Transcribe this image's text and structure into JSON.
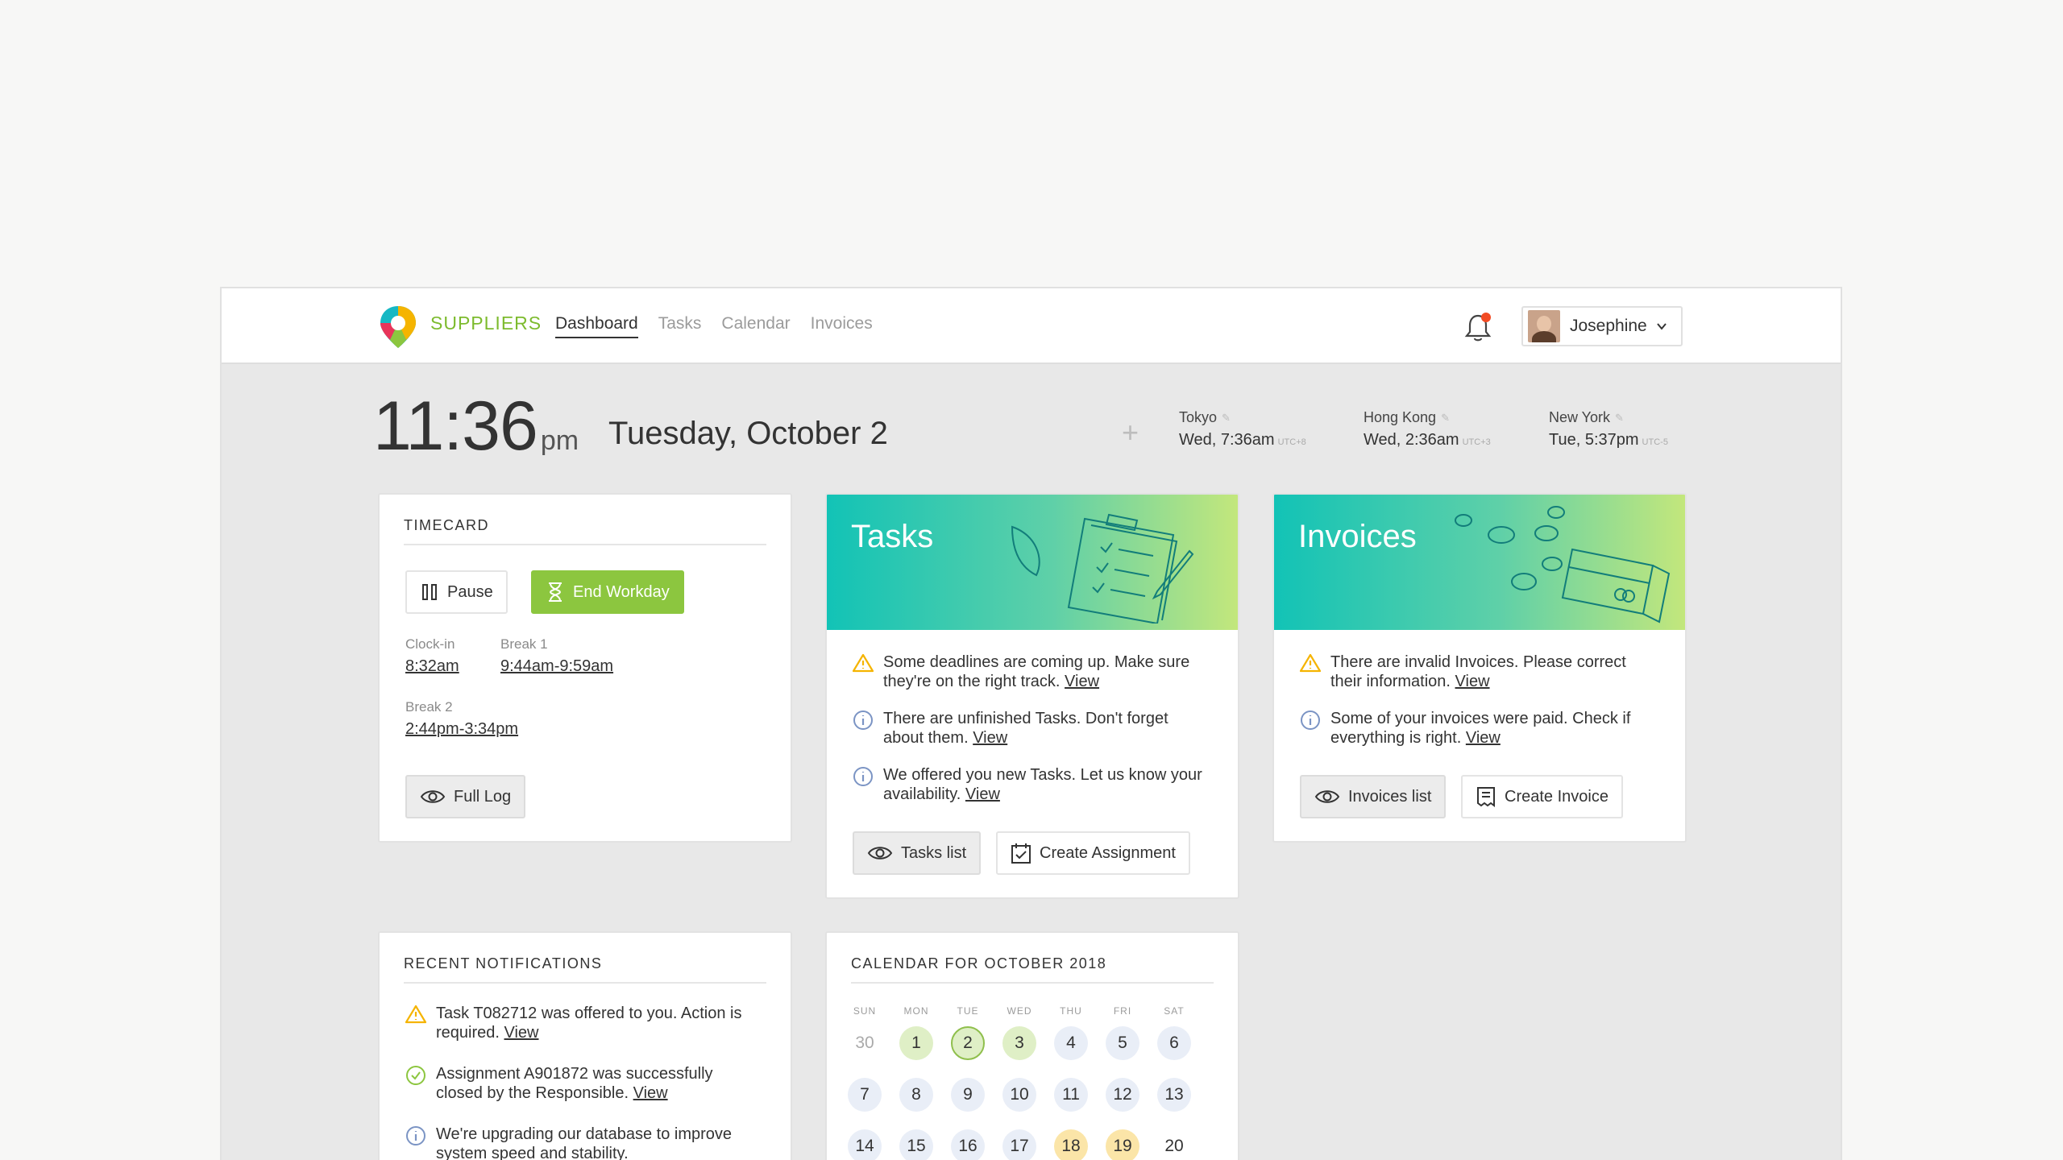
{
  "brand": "SUPPLIERS",
  "nav": [
    "Dashboard",
    "Tasks",
    "Calendar",
    "Invoices"
  ],
  "user": {
    "name": "Josephine"
  },
  "clock": {
    "time": "11:36",
    "ampm": "pm",
    "date": "Tuesday, October 2",
    "add": "+"
  },
  "zones": [
    {
      "city": "Tokyo",
      "datetime": "Wed, 7:36am",
      "utc": "UTC+8"
    },
    {
      "city": "Hong Kong",
      "datetime": "Wed, 2:36am",
      "utc": "UTC+3"
    },
    {
      "city": "New York",
      "datetime": "Tue, 5:37pm",
      "utc": "UTC-5"
    }
  ],
  "timecard": {
    "title": "TIMECARD",
    "pause": "Pause",
    "end": "End Workday",
    "clockin_label": "Clock-in",
    "clockin": "8:32am",
    "break1_label": "Break 1",
    "break1": "9:44am-9:59am",
    "break2_label": "Break 2",
    "break2": "2:44pm-3:34pm",
    "full_log": "Full Log"
  },
  "tasks": {
    "title": "Tasks",
    "messages": [
      {
        "type": "warning",
        "text": "Some deadlines are coming up. Make sure they're on the right track.",
        "link": "View"
      },
      {
        "type": "info",
        "text": "There are unfinished Tasks. Don't forget about them.",
        "link": "View"
      },
      {
        "type": "info",
        "text": "We offered you new Tasks. Let us know your availability.",
        "link": "View"
      }
    ],
    "list_btn": "Tasks list",
    "create_btn": "Create Assignment"
  },
  "invoices": {
    "title": "Invoices",
    "messages": [
      {
        "type": "warning",
        "text": "There are invalid Invoices. Please correct their information.",
        "link": "View"
      },
      {
        "type": "info",
        "text": "Some of your invoices were paid. Check if everything is right.",
        "link": "View"
      }
    ],
    "list_btn": "Invoices list",
    "create_btn": "Create Invoice"
  },
  "notifications": {
    "title": "RECENT NOTIFICATIONS",
    "items": [
      {
        "type": "warning",
        "text": "Task T082712 was offered to you. Action is required.",
        "link": "View"
      },
      {
        "type": "success",
        "text": "Assignment A901872 was successfully closed by the Responsible.",
        "link": "View"
      },
      {
        "type": "info",
        "text": "We're upgrading our database to improve system speed and stability.",
        "link": ""
      }
    ]
  },
  "calendar": {
    "title": "CALENDAR FOR OCTOBER 2018",
    "weekdays": [
      "SUN",
      "MON",
      "TUE",
      "WED",
      "THU",
      "FRI",
      "SAT"
    ],
    "weeks": [
      [
        "30",
        "1",
        "2",
        "3",
        "4",
        "5",
        "6"
      ],
      [
        "7",
        "8",
        "9",
        "10",
        "11",
        "12",
        "13"
      ],
      [
        "14",
        "15",
        "16",
        "17",
        "18",
        "19",
        "20"
      ]
    ]
  },
  "colors": {
    "brand_green": "#7dbb2e",
    "button_green": "#8cc63f",
    "warning": "#f5b400",
    "info": "#7b94c4",
    "success": "#8cc63f",
    "notification_dot": "#f24b24"
  }
}
